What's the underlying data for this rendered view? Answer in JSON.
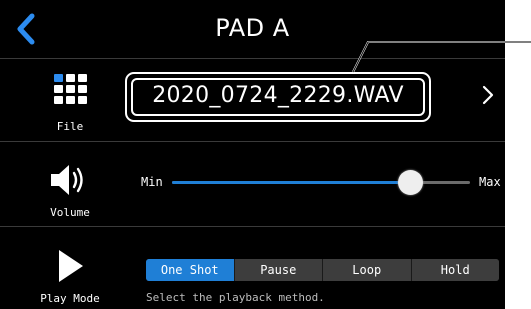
{
  "header": {
    "title": "PAD A"
  },
  "file": {
    "label": "File",
    "filename": "2020_0724_2229.WAV"
  },
  "volume": {
    "label": "Volume",
    "min_label": "Min",
    "max_label": "Max",
    "level": 0.8
  },
  "play_mode": {
    "label": "Play Mode",
    "options": [
      "One Shot",
      "Pause",
      "Loop",
      "Hold"
    ],
    "selected": "One Shot",
    "hint": "Select the playback method."
  },
  "colors": {
    "accent": "#1f7fd6",
    "background": "#000000",
    "text": "#ffffff"
  },
  "icons": {
    "back": "chevron-left-icon",
    "file": "grid-icon",
    "next": "chevron-right-icon",
    "volume": "speaker-icon",
    "play_mode": "play-icon"
  }
}
